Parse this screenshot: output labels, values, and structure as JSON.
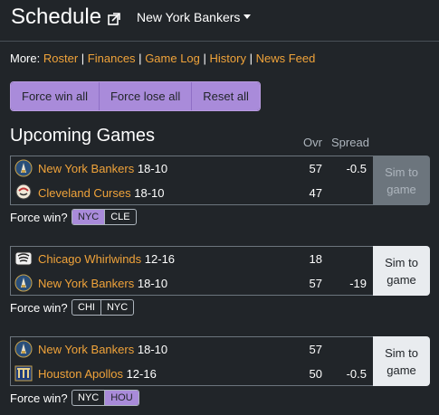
{
  "header": {
    "title": "Schedule",
    "team_dropdown": "New York Bankers"
  },
  "more": {
    "label": "More:",
    "links": [
      "Roster",
      "Finances",
      "Game Log",
      "History",
      "News Feed"
    ],
    "sep": "|"
  },
  "force_buttons": [
    "Force win all",
    "Force lose all",
    "Reset all"
  ],
  "section_title": "Upcoming Games",
  "columns": {
    "ovr": "Ovr",
    "spread": "Spread"
  },
  "force_label": "Force win?",
  "sim_label_1": "Sim to",
  "sim_label_2": "game",
  "games": [
    {
      "teams": [
        {
          "name": "New York Bankers",
          "record": "18-10",
          "ovr": "57",
          "spread": "-0.5",
          "logo": "bankers-logo"
        },
        {
          "name": "Cleveland Curses",
          "record": "18-10",
          "ovr": "47",
          "spread": "",
          "logo": "curses-logo"
        }
      ],
      "force": [
        {
          "label": "NYC",
          "active": true
        },
        {
          "label": "CLE",
          "active": false
        }
      ],
      "sim_disabled": true
    },
    {
      "teams": [
        {
          "name": "Chicago Whirlwinds",
          "record": "12-16",
          "ovr": "18",
          "spread": "",
          "logo": "whirlwinds-logo"
        },
        {
          "name": "New York Bankers",
          "record": "18-10",
          "ovr": "57",
          "spread": "-19",
          "logo": "bankers-logo"
        }
      ],
      "force": [
        {
          "label": "CHI",
          "active": false
        },
        {
          "label": "NYC",
          "active": false
        }
      ],
      "sim_disabled": false
    },
    {
      "teams": [
        {
          "name": "New York Bankers",
          "record": "18-10",
          "ovr": "57",
          "spread": "",
          "logo": "bankers-logo"
        },
        {
          "name": "Houston Apollos",
          "record": "12-16",
          "ovr": "50",
          "spread": "-0.5",
          "logo": "apollos-logo"
        }
      ],
      "force": [
        {
          "label": "NYC",
          "active": false
        },
        {
          "label": "HOU",
          "active": true
        }
      ],
      "sim_disabled": false
    }
  ],
  "colors": {
    "accent": "#a98bda",
    "link": "#f0a33a",
    "background": "#212529"
  }
}
